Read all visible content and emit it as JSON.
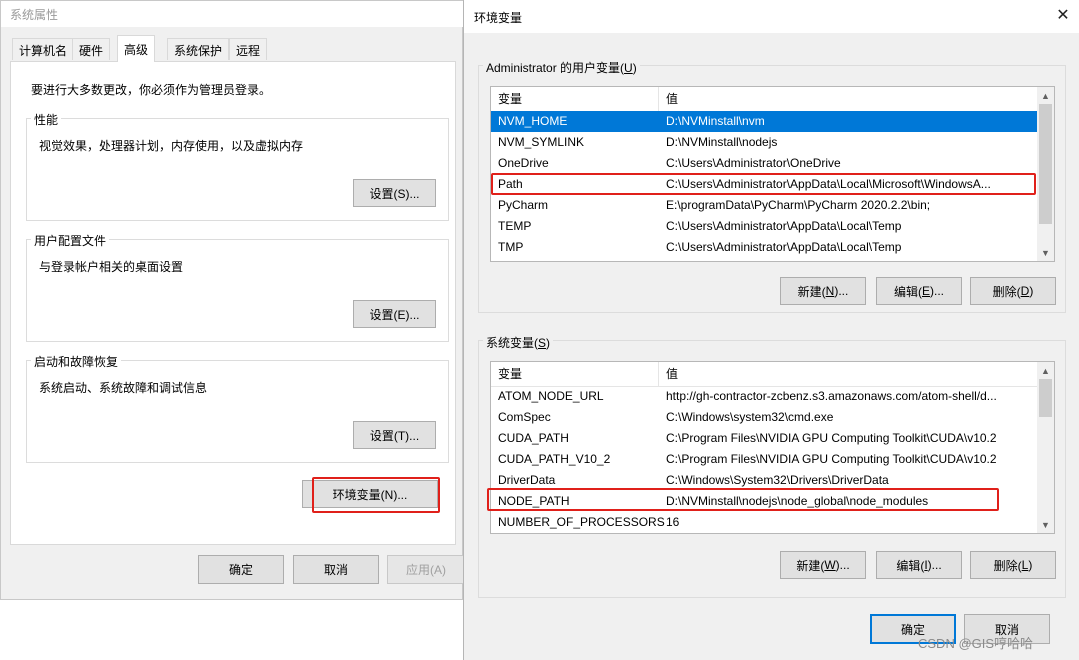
{
  "system_properties": {
    "title": "系统属性",
    "tabs": [
      "计算机名",
      "硬件",
      "高级",
      "系统保护",
      "远程"
    ],
    "active_tab": "高级",
    "admin_note": "要进行大多数更改，你必须作为管理员登录。",
    "performance": {
      "title": "性能",
      "desc": "视觉效果，处理器计划，内存使用，以及虚拟内存",
      "button": "设置(S)..."
    },
    "user_profile": {
      "title": "用户配置文件",
      "desc": "与登录帐户相关的桌面设置",
      "button": "设置(E)..."
    },
    "startup": {
      "title": "启动和故障恢复",
      "desc": "系统启动、系统故障和调试信息",
      "button": "设置(T)..."
    },
    "env_button": "环境变量(N)...",
    "footer": {
      "ok": "确定",
      "cancel": "取消",
      "apply": "应用(A)"
    }
  },
  "env_vars": {
    "title": "环境变量",
    "user_section": {
      "label_prefix": "Administrator 的用户变量(",
      "label_key": "U",
      "label_suffix": ")",
      "columns": [
        "变量",
        "值"
      ],
      "rows": [
        {
          "name": "NVM_HOME",
          "value": "D:\\NVMinstall\\nvm",
          "selected": true
        },
        {
          "name": "NVM_SYMLINK",
          "value": "D:\\NVMinstall\\nodejs"
        },
        {
          "name": "OneDrive",
          "value": "C:\\Users\\Administrator\\OneDrive"
        },
        {
          "name": "Path",
          "value": "C:\\Users\\Administrator\\AppData\\Local\\Microsoft\\WindowsA...",
          "highlighted": true
        },
        {
          "name": "PyCharm",
          "value": "E:\\programData\\PyCharm\\PyCharm 2020.2.2\\bin;"
        },
        {
          "name": "TEMP",
          "value": "C:\\Users\\Administrator\\AppData\\Local\\Temp"
        },
        {
          "name": "TMP",
          "value": "C:\\Users\\Administrator\\AppData\\Local\\Temp"
        }
      ],
      "buttons": {
        "new": {
          "pre": "新建(",
          "key": "N",
          "post": ")..."
        },
        "edit": {
          "pre": "编辑(",
          "key": "E",
          "post": ")..."
        },
        "delete": {
          "pre": "删除(",
          "key": "D",
          "post": ")"
        }
      }
    },
    "system_section": {
      "label_prefix": "系统变量(",
      "label_key": "S",
      "label_suffix": ")",
      "columns": [
        "变量",
        "值"
      ],
      "rows": [
        {
          "name": "ATOM_NODE_URL",
          "value": "http://gh-contractor-zcbenz.s3.amazonaws.com/atom-shell/d..."
        },
        {
          "name": "ComSpec",
          "value": "C:\\Windows\\system32\\cmd.exe"
        },
        {
          "name": "CUDA_PATH",
          "value": "C:\\Program Files\\NVIDIA GPU Computing Toolkit\\CUDA\\v10.2"
        },
        {
          "name": "CUDA_PATH_V10_2",
          "value": "C:\\Program Files\\NVIDIA GPU Computing Toolkit\\CUDA\\v10.2"
        },
        {
          "name": "DriverData",
          "value": "C:\\Windows\\System32\\Drivers\\DriverData"
        },
        {
          "name": "NODE_PATH",
          "value": "D:\\NVMinstall\\nodejs\\node_global\\node_modules",
          "highlighted": true
        },
        {
          "name": "NUMBER_OF_PROCESSORS",
          "value": "16"
        }
      ],
      "buttons": {
        "new": {
          "pre": "新建(",
          "key": "W",
          "post": ")..."
        },
        "edit": {
          "pre": "编辑(",
          "key": "I",
          "post": ")..."
        },
        "delete": {
          "pre": "删除(",
          "key": "L",
          "post": ")"
        }
      }
    },
    "footer": {
      "ok": "确定",
      "cancel": "取消"
    }
  },
  "watermark": "CSDN @GIS哼哈哈",
  "colors": {
    "selection": "#0078d7",
    "highlight_outline": "#e0201a",
    "dialog_bg": "#f0f0f0"
  }
}
